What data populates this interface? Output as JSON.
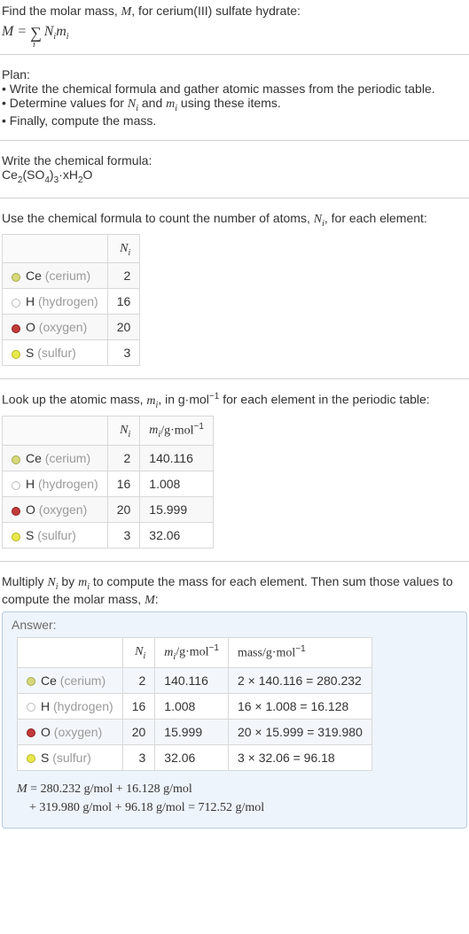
{
  "intro": {
    "line1": "Find the molar mass, ",
    "line1b": ", for cerium(III) sulfate hydrate:",
    "Mvar": "M",
    "equals": " = ",
    "sigma": "∑",
    "idx": "i",
    "Nimi": "N_i m_i"
  },
  "plan": {
    "heading": "Plan:",
    "b1a": "• Write the chemical formula and gather atomic masses from the periodic table.",
    "b2a": "• Determine values for ",
    "b2b": " and ",
    "b2c": " using these items.",
    "Ni": "N_i",
    "mi": "m_i",
    "b3": "• Finally, compute the mass."
  },
  "chemline": {
    "lead": "Write the chemical formula:",
    "formula_parts": {
      "p1": "Ce",
      "s1": "2",
      "p2": "(SO",
      "s2": "4",
      "p3": ")",
      "s3": "3",
      "p4": "·xH",
      "s4": "2",
      "p5": "O"
    }
  },
  "countline": {
    "lead_a": "Use the chemical formula to count the number of atoms, ",
    "lead_b": ", for each element:",
    "Ni": "N_i"
  },
  "table1": {
    "h_Ni": "N_i",
    "rows": [
      {
        "dot": "ce",
        "sym": "Ce",
        "name": "(cerium)",
        "n": "2"
      },
      {
        "dot": "h",
        "sym": "H",
        "name": "(hydrogen)",
        "n": "16"
      },
      {
        "dot": "o",
        "sym": "O",
        "name": "(oxygen)",
        "n": "20"
      },
      {
        "dot": "s",
        "sym": "S",
        "name": "(sulfur)",
        "n": "3"
      }
    ]
  },
  "lookline": {
    "lead_a": "Look up the atomic mass, ",
    "lead_b": ", in g·mol",
    "lead_c": " for each element in the periodic table:",
    "mi": "m_i",
    "neg": "−1"
  },
  "table2": {
    "h_Ni": "N_i",
    "h_mi": "m_i/g·mol",
    "neg": "−1",
    "rows": [
      {
        "dot": "ce",
        "sym": "Ce",
        "name": "(cerium)",
        "n": "2",
        "m": "140.116"
      },
      {
        "dot": "h",
        "sym": "H",
        "name": "(hydrogen)",
        "n": "16",
        "m": "1.008"
      },
      {
        "dot": "o",
        "sym": "O",
        "name": "(oxygen)",
        "n": "20",
        "m": "15.999"
      },
      {
        "dot": "s",
        "sym": "S",
        "name": "(sulfur)",
        "n": "3",
        "m": "32.06"
      }
    ]
  },
  "multline": {
    "a": "Multiply ",
    "b": " by ",
    "c": " to compute the mass for each element. Then sum those values to compute the molar mass, ",
    "d": ":",
    "Ni": "N_i",
    "mi": "m_i",
    "M": "M"
  },
  "answer": {
    "label": "Answer:",
    "h_Ni": "N_i",
    "h_mi": "m_i/g·mol",
    "h_mass": "mass/g·mol",
    "neg": "−1",
    "rows": [
      {
        "dot": "ce",
        "sym": "Ce",
        "name": "(cerium)",
        "n": "2",
        "m": "140.116",
        "mass": "2 × 140.116 = 280.232"
      },
      {
        "dot": "h",
        "sym": "H",
        "name": "(hydrogen)",
        "n": "16",
        "m": "1.008",
        "mass": "16 × 1.008 = 16.128"
      },
      {
        "dot": "o",
        "sym": "O",
        "name": "(oxygen)",
        "n": "20",
        "m": "15.999",
        "mass": "20 × 15.999 = 319.980"
      },
      {
        "dot": "s",
        "sym": "S",
        "name": "(sulfur)",
        "n": "3",
        "m": "32.06",
        "mass": "3 × 32.06 = 96.18"
      }
    ],
    "final1": "M = 280.232 g/mol + 16.128 g/mol",
    "final2": "    + 319.980 g/mol + 96.18 g/mol = 712.52 g/mol"
  }
}
